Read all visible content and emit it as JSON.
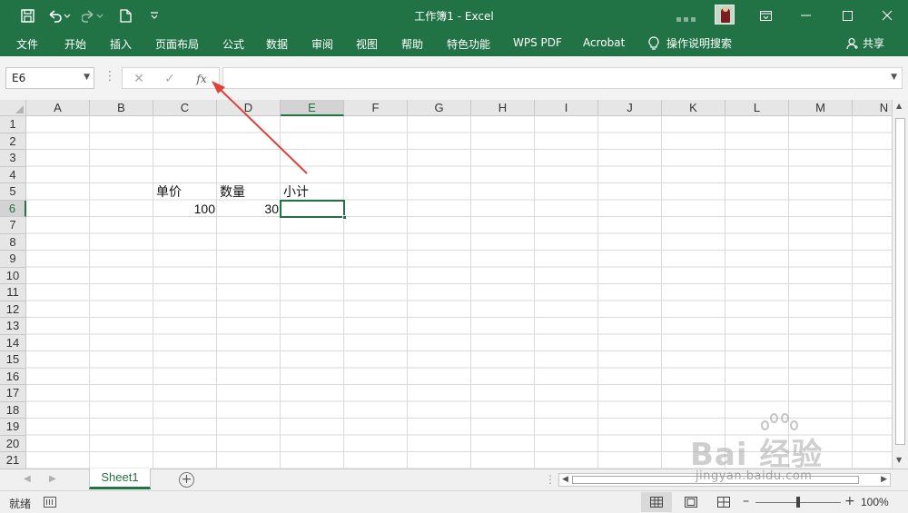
{
  "window": {
    "title": "工作簿1  -  Excel",
    "accent": "#217346"
  },
  "quick_access": [
    "save-icon",
    "undo-icon",
    "redo-icon",
    "new-document-icon",
    "customize-icon"
  ],
  "ribbon": {
    "tabs": [
      "文件",
      "开始",
      "插入",
      "页面布局",
      "公式",
      "数据",
      "审阅",
      "视图",
      "帮助",
      "特色功能",
      "WPS PDF",
      "Acrobat"
    ],
    "tell_me": "操作说明搜索",
    "share": "共享"
  },
  "formula_bar": {
    "name_box": "E6",
    "fx_label": "fx",
    "value": ""
  },
  "sheet": {
    "columns": [
      "A",
      "B",
      "C",
      "D",
      "E",
      "F",
      "G",
      "H",
      "I",
      "J",
      "K",
      "L",
      "M",
      "N"
    ],
    "rows": [
      "1",
      "2",
      "3",
      "4",
      "5",
      "6",
      "7",
      "8",
      "9",
      "10",
      "11",
      "12",
      "13",
      "14",
      "15",
      "16",
      "17",
      "18",
      "19",
      "20",
      "21"
    ],
    "selected_column": "E",
    "selected_row": "6",
    "cells": {
      "C5": "单价",
      "D5": "数量",
      "E5": "小计",
      "C6": "100",
      "D6": "30"
    }
  },
  "sheet_tabs": [
    "Sheet1"
  ],
  "status": {
    "ready": "就绪",
    "zoom": "100%",
    "zoom_level": 100
  },
  "watermark": {
    "brand": "Bai 经验",
    "url": "jingyan.baidu.com"
  }
}
